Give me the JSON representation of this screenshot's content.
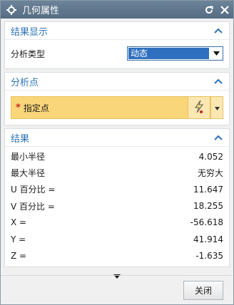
{
  "window": {
    "title": "几何属性"
  },
  "display_section": {
    "title": "结果显示",
    "type_label": "分析类型",
    "type_value": "动态"
  },
  "point_section": {
    "title": "分析点",
    "required_mark": "*",
    "specify_point_label": "指定点"
  },
  "results_section": {
    "title": "结果",
    "rows": [
      {
        "label": "最小半径",
        "value": "4.052"
      },
      {
        "label": "最大半径",
        "value": "无穷大"
      },
      {
        "label": "U 百分比 =",
        "value": "11.647"
      },
      {
        "label": "V 百分比 =",
        "value": "18.255"
      },
      {
        "label": "X =",
        "value": "-56.618"
      },
      {
        "label": "Y =",
        "value": "41.914"
      },
      {
        "label": "Z =",
        "value": "-1.635"
      }
    ]
  },
  "footer": {
    "close_label": "关闭"
  },
  "colors": {
    "titlebar": "#5f778d",
    "section_title": "#2b73b5",
    "highlight": "#fad67a"
  }
}
